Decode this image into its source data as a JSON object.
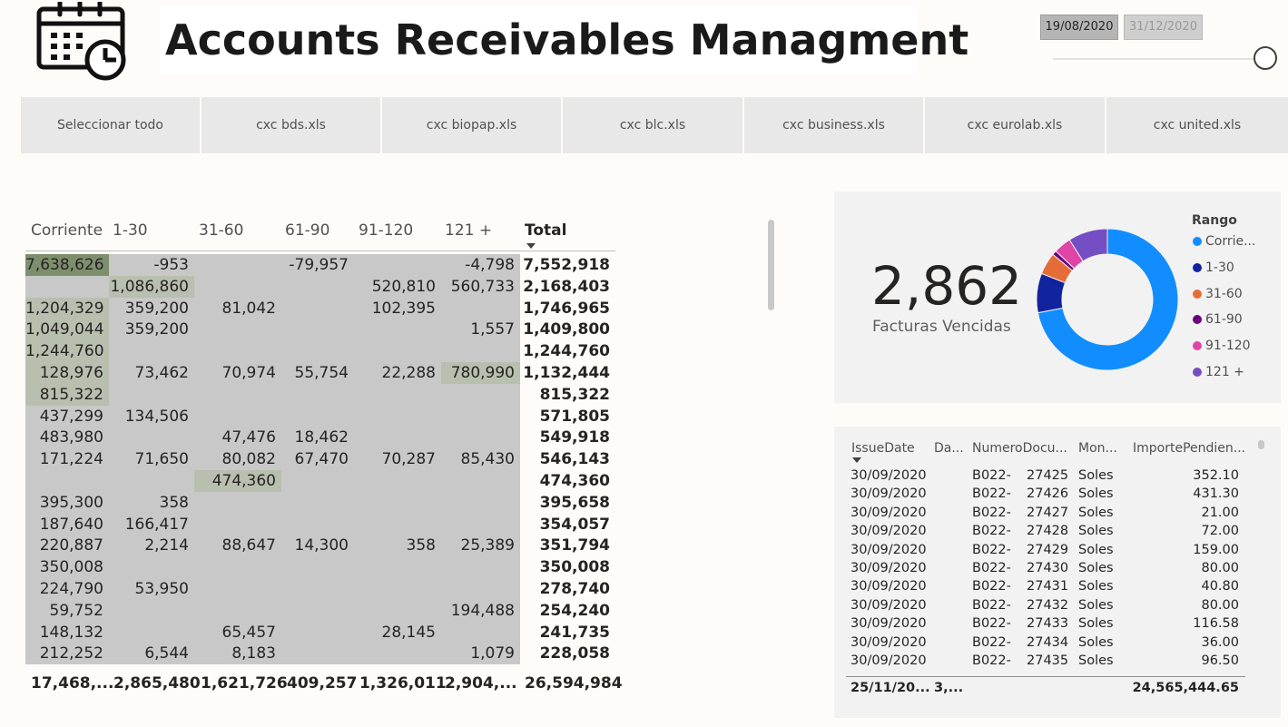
{
  "header": {
    "title": "Accounts Receivables Managment",
    "logo_icon": "calendar-clock-icon",
    "date_start": "19/08/2020",
    "date_end": "31/12/2020"
  },
  "slicer": {
    "items": [
      "Seleccionar todo",
      "cxc bds.xls",
      "cxc biopap.xls",
      "cxc blc.xls",
      "cxc business.xls",
      "cxc eurolab.xls",
      "cxc united.xls"
    ]
  },
  "matrix": {
    "columns": [
      "Corriente",
      "1-30",
      "31-60",
      "61-90",
      "91-120",
      "121 +",
      "Total"
    ],
    "rows": [
      [
        "7,638,626",
        "-953",
        "",
        "-79,957",
        "",
        "-4,798",
        "7,552,918"
      ],
      [
        "",
        "1,086,860",
        "",
        "",
        "520,810",
        "560,733",
        "2,168,403"
      ],
      [
        "1,204,329",
        "359,200",
        "81,042",
        "",
        "102,395",
        "",
        "1,746,965"
      ],
      [
        "1,049,044",
        "359,200",
        "",
        "",
        "",
        "1,557",
        "1,409,800"
      ],
      [
        "1,244,760",
        "",
        "",
        "",
        "",
        "",
        "1,244,760"
      ],
      [
        "128,976",
        "73,462",
        "70,974",
        "55,754",
        "22,288",
        "780,990",
        "1,132,444"
      ],
      [
        "815,322",
        "",
        "",
        "",
        "",
        "",
        "815,322"
      ],
      [
        "437,299",
        "134,506",
        "",
        "",
        "",
        "",
        "571,805"
      ],
      [
        "483,980",
        "",
        "47,476",
        "18,462",
        "",
        "",
        "549,918"
      ],
      [
        "171,224",
        "71,650",
        "80,082",
        "67,470",
        "70,287",
        "85,430",
        "546,143"
      ],
      [
        "",
        "",
        "474,360",
        "",
        "",
        "",
        "474,360"
      ],
      [
        "395,300",
        "358",
        "",
        "",
        "",
        "",
        "395,658"
      ],
      [
        "187,640",
        "166,417",
        "",
        "",
        "",
        "",
        "354,057"
      ],
      [
        "220,887",
        "2,214",
        "88,647",
        "14,300",
        "358",
        "25,389",
        "351,794"
      ],
      [
        "350,008",
        "",
        "",
        "",
        "",
        "",
        "350,008"
      ],
      [
        "224,790",
        "53,950",
        "",
        "",
        "",
        "",
        "278,740"
      ],
      [
        "59,752",
        "",
        "",
        "",
        "",
        "194,488",
        "254,240"
      ],
      [
        "148,132",
        "",
        "65,457",
        "",
        "28,145",
        "",
        "241,735"
      ],
      [
        "212,252",
        "6,544",
        "8,183",
        "",
        "",
        "1,079",
        "228,058"
      ]
    ],
    "totals": [
      "17,468,...",
      "2,865,480",
      "1,621,726",
      "409,257",
      "1,326,011",
      "2,904,...",
      "26,594,984"
    ],
    "colors": {
      "cell": "#c8c8c8",
      "highlight_dark": "#7e8f6e",
      "highlight_light": "#b9bfae"
    }
  },
  "kpi": {
    "value": "2,862",
    "label": "Facturas Vencidas"
  },
  "chart_data": {
    "type": "pie",
    "legend_title": "Rango",
    "legend_placement": "right",
    "categories": [
      "Corrie...",
      "1-30",
      "31-60",
      "61-90",
      "91-120",
      "121 +"
    ],
    "values": [
      72,
      9,
      5,
      1,
      4,
      9
    ],
    "colors": [
      "#118DFF",
      "#12239E",
      "#E66C37",
      "#6B007B",
      "#E044A7",
      "#744EC2"
    ],
    "donut": true
  },
  "invoices": {
    "columns": [
      "IssueDate",
      "Da...",
      "NumeroDocu...",
      "Mon...",
      "ImportePendien..."
    ],
    "rows": [
      [
        "30/09/2020",
        "",
        "B022-",
        "27425",
        "Soles",
        "352.10"
      ],
      [
        "30/09/2020",
        "",
        "B022-",
        "27426",
        "Soles",
        "431.30"
      ],
      [
        "30/09/2020",
        "",
        "B022-",
        "27427",
        "Soles",
        "21.00"
      ],
      [
        "30/09/2020",
        "",
        "B022-",
        "27428",
        "Soles",
        "72.00"
      ],
      [
        "30/09/2020",
        "",
        "B022-",
        "27429",
        "Soles",
        "159.00"
      ],
      [
        "30/09/2020",
        "",
        "B022-",
        "27430",
        "Soles",
        "80.00"
      ],
      [
        "30/09/2020",
        "",
        "B022-",
        "27431",
        "Soles",
        "40.80"
      ],
      [
        "30/09/2020",
        "",
        "B022-",
        "27432",
        "Soles",
        "80.00"
      ],
      [
        "30/09/2020",
        "",
        "B022-",
        "27433",
        "Soles",
        "116.58"
      ],
      [
        "30/09/2020",
        "",
        "B022-",
        "27434",
        "Soles",
        "36.00"
      ],
      [
        "30/09/2020",
        "",
        "B022-",
        "27435",
        "Soles",
        "96.50"
      ]
    ],
    "totals": [
      "25/11/20...",
      "3,...",
      "",
      "",
      "",
      "24,565,444.65"
    ]
  }
}
